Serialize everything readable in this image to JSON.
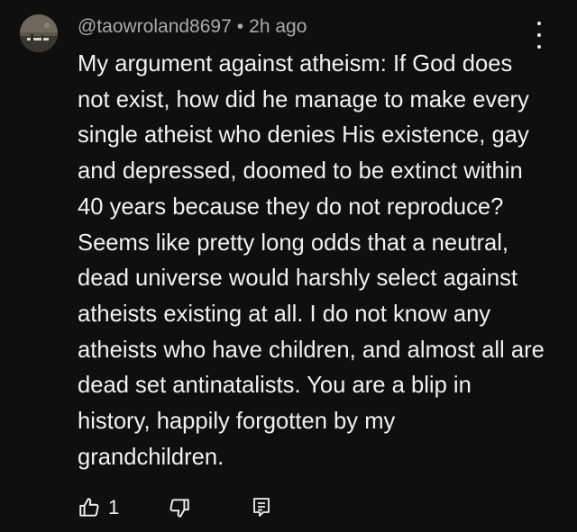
{
  "comment": {
    "author": "@taowroland8697",
    "separator": "•",
    "time": "2h ago",
    "text": "My argument against atheism: If God does not exist, how did he manage to make every single atheist who denies His existence, gay and depressed, doomed to be extinct within 40 years because they do not reproduce? Seems like pretty long odds that a neutral, dead universe would harshly select against atheists existing at all. I do not know any atheists who have children, and almost all are dead set antinatalists. You are a blip in history, happily forgotten by my grandchildren.",
    "like_count": "1"
  },
  "icons": {
    "like": "thumb-up-icon",
    "dislike": "thumb-down-icon",
    "reply": "reply-comment-icon",
    "more": "more-vertical-icon"
  },
  "colors": {
    "background": "#0f0f0f",
    "text": "#f1f1f1",
    "meta": "#aaaaaa"
  }
}
